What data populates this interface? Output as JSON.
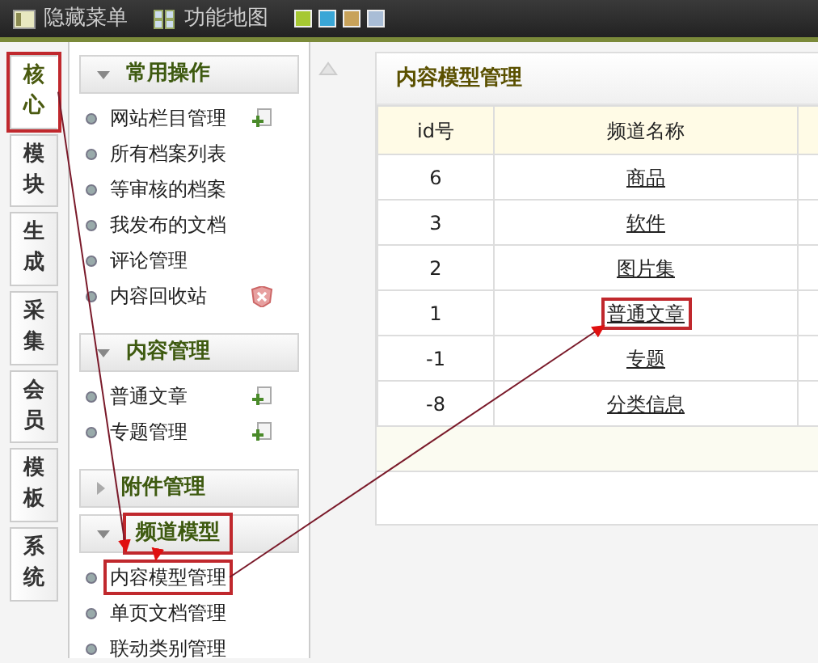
{
  "topbar": {
    "items": [
      {
        "label": "隐藏菜单",
        "kind": "hide"
      },
      {
        "label": "功能地图",
        "kind": "map"
      }
    ],
    "skins": [
      {
        "color": "#a6c832"
      },
      {
        "color": "#3aa6d6"
      },
      {
        "color": "#c8a25a"
      },
      {
        "color": "#a9bdd6"
      }
    ]
  },
  "side_tabs": [
    {
      "label": "核心",
      "selected": true,
      "highlighted": true
    },
    {
      "label": "模块",
      "selected": false,
      "highlighted": false
    },
    {
      "label": "生成",
      "selected": false,
      "highlighted": false
    },
    {
      "label": "采集",
      "selected": false,
      "highlighted": false
    },
    {
      "label": "会员",
      "selected": false,
      "highlighted": false
    },
    {
      "label": "模板",
      "selected": false,
      "highlighted": false
    },
    {
      "label": "系统",
      "selected": false,
      "highlighted": false
    }
  ],
  "menu_sections": [
    {
      "title": "常用操作",
      "expanded": true,
      "highlighted": false,
      "items": [
        {
          "label": "网站栏目管理",
          "kind": "add",
          "highlighted": false
        },
        {
          "label": "所有档案列表",
          "kind": "plain",
          "highlighted": false
        },
        {
          "label": "等审核的档案",
          "kind": "plain",
          "highlighted": false
        },
        {
          "label": "我发布的文档",
          "kind": "plain",
          "highlighted": false
        },
        {
          "label": "评论管理",
          "kind": "plain",
          "highlighted": false
        },
        {
          "label": "内容回收站",
          "kind": "delete",
          "highlighted": false
        }
      ]
    },
    {
      "title": "内容管理",
      "expanded": true,
      "highlighted": false,
      "items": [
        {
          "label": "普通文章",
          "kind": "add",
          "highlighted": false
        },
        {
          "label": "专题管理",
          "kind": "add",
          "highlighted": false
        }
      ]
    },
    {
      "title": "附件管理",
      "expanded": false,
      "highlighted": false
    },
    {
      "title": "频道模型",
      "expanded": true,
      "highlighted": true,
      "items": [
        {
          "label": "内容模型管理",
          "kind": "plain",
          "highlighted": true
        },
        {
          "label": "单页文档管理",
          "kind": "plain",
          "highlighted": false
        },
        {
          "label": "联动类别管理",
          "kind": "plain",
          "highlighted": false
        }
      ]
    }
  ],
  "panel": {
    "title": "内容模型管理",
    "table": {
      "columns": [
        "id号",
        "频道名称"
      ],
      "rows": [
        {
          "id": "6",
          "name": "商品",
          "highlighted": false
        },
        {
          "id": "3",
          "name": "软件",
          "highlighted": false
        },
        {
          "id": "2",
          "name": "图片集",
          "highlighted": false
        },
        {
          "id": "1",
          "name": "普通文章",
          "highlighted": true
        },
        {
          "id": "-1",
          "name": "专题",
          "highlighted": false
        },
        {
          "id": "-8",
          "name": "分类信息",
          "highlighted": false
        }
      ]
    }
  }
}
